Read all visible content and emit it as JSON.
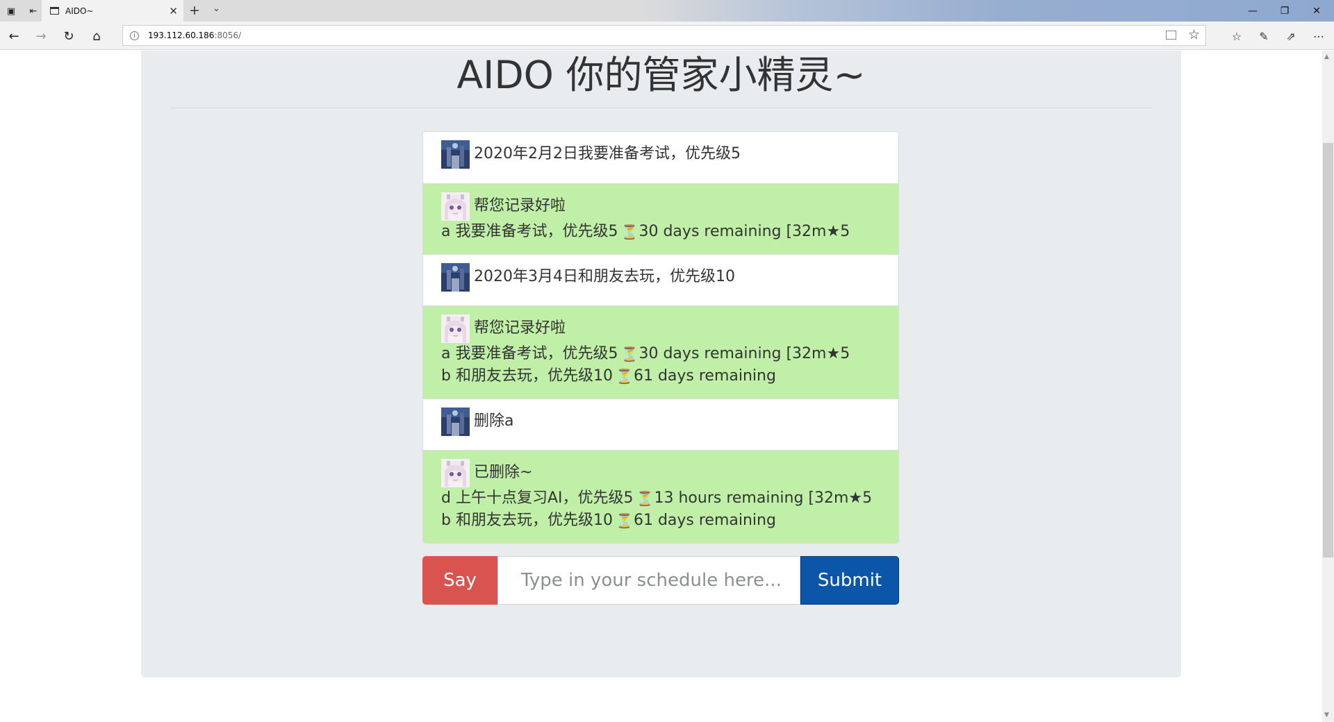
{
  "browser": {
    "tab_title": "AIDO~",
    "url_host": "193.112.60.186",
    "url_rest": ":8056/",
    "icons": [
      "tab-actions-icon",
      "set-aside-tabs-icon",
      "page-icon",
      "close-tab-icon",
      "new-tab-icon",
      "tab-menu-icon",
      "minimize-icon",
      "maximize-icon",
      "close-window-icon",
      "back-icon",
      "forward-icon",
      "refresh-icon",
      "home-icon",
      "info-icon",
      "reading-view-icon",
      "favorite-star-icon",
      "favorites-hub-icon",
      "pen-icon",
      "share-icon",
      "more-icon"
    ]
  },
  "page": {
    "title": "AIDO 你的管家小精灵~"
  },
  "chat": {
    "messages": [
      {
        "role": "user",
        "avatar": "user-avatar",
        "text": "2020年2月2日我要准备考试，优先级5"
      },
      {
        "role": "bot",
        "avatar": "bot-avatar",
        "text": "帮您记录好啦",
        "lines": [
          {
            "prefix": "a 我要准备考试，优先级5",
            "suffix": "30 days remaining [32m★5"
          }
        ]
      },
      {
        "role": "user",
        "avatar": "user-avatar",
        "text": "2020年3月4日和朋友去玩，优先级10"
      },
      {
        "role": "bot",
        "avatar": "bot-avatar",
        "text": "帮您记录好啦",
        "lines": [
          {
            "prefix": "a 我要准备考试，优先级5",
            "suffix": "30 days remaining [32m★5"
          },
          {
            "prefix": "b 和朋友去玩，优先级10",
            "suffix": "61 days remaining"
          }
        ]
      },
      {
        "role": "user",
        "avatar": "user-avatar",
        "text": "删除a"
      },
      {
        "role": "bot",
        "avatar": "bot-avatar",
        "text": "已删除~",
        "lines": [
          {
            "prefix": "d 上午十点复习AI，优先级5",
            "suffix": "13 hours remaining [32m★5"
          },
          {
            "prefix": "b 和朋友去玩，优先级10",
            "suffix": "61 days remaining"
          }
        ]
      }
    ],
    "hourglass": "⏳"
  },
  "form": {
    "say_label": "Say",
    "input_value": "",
    "input_placeholder": "Type in your schedule here...",
    "submit_label": "Submit"
  },
  "colors": {
    "page_bg": "#e9ecef",
    "bot_bubble": "#c0f0a8",
    "say_button": "#d9534f",
    "submit_button": "#0b56a8"
  }
}
